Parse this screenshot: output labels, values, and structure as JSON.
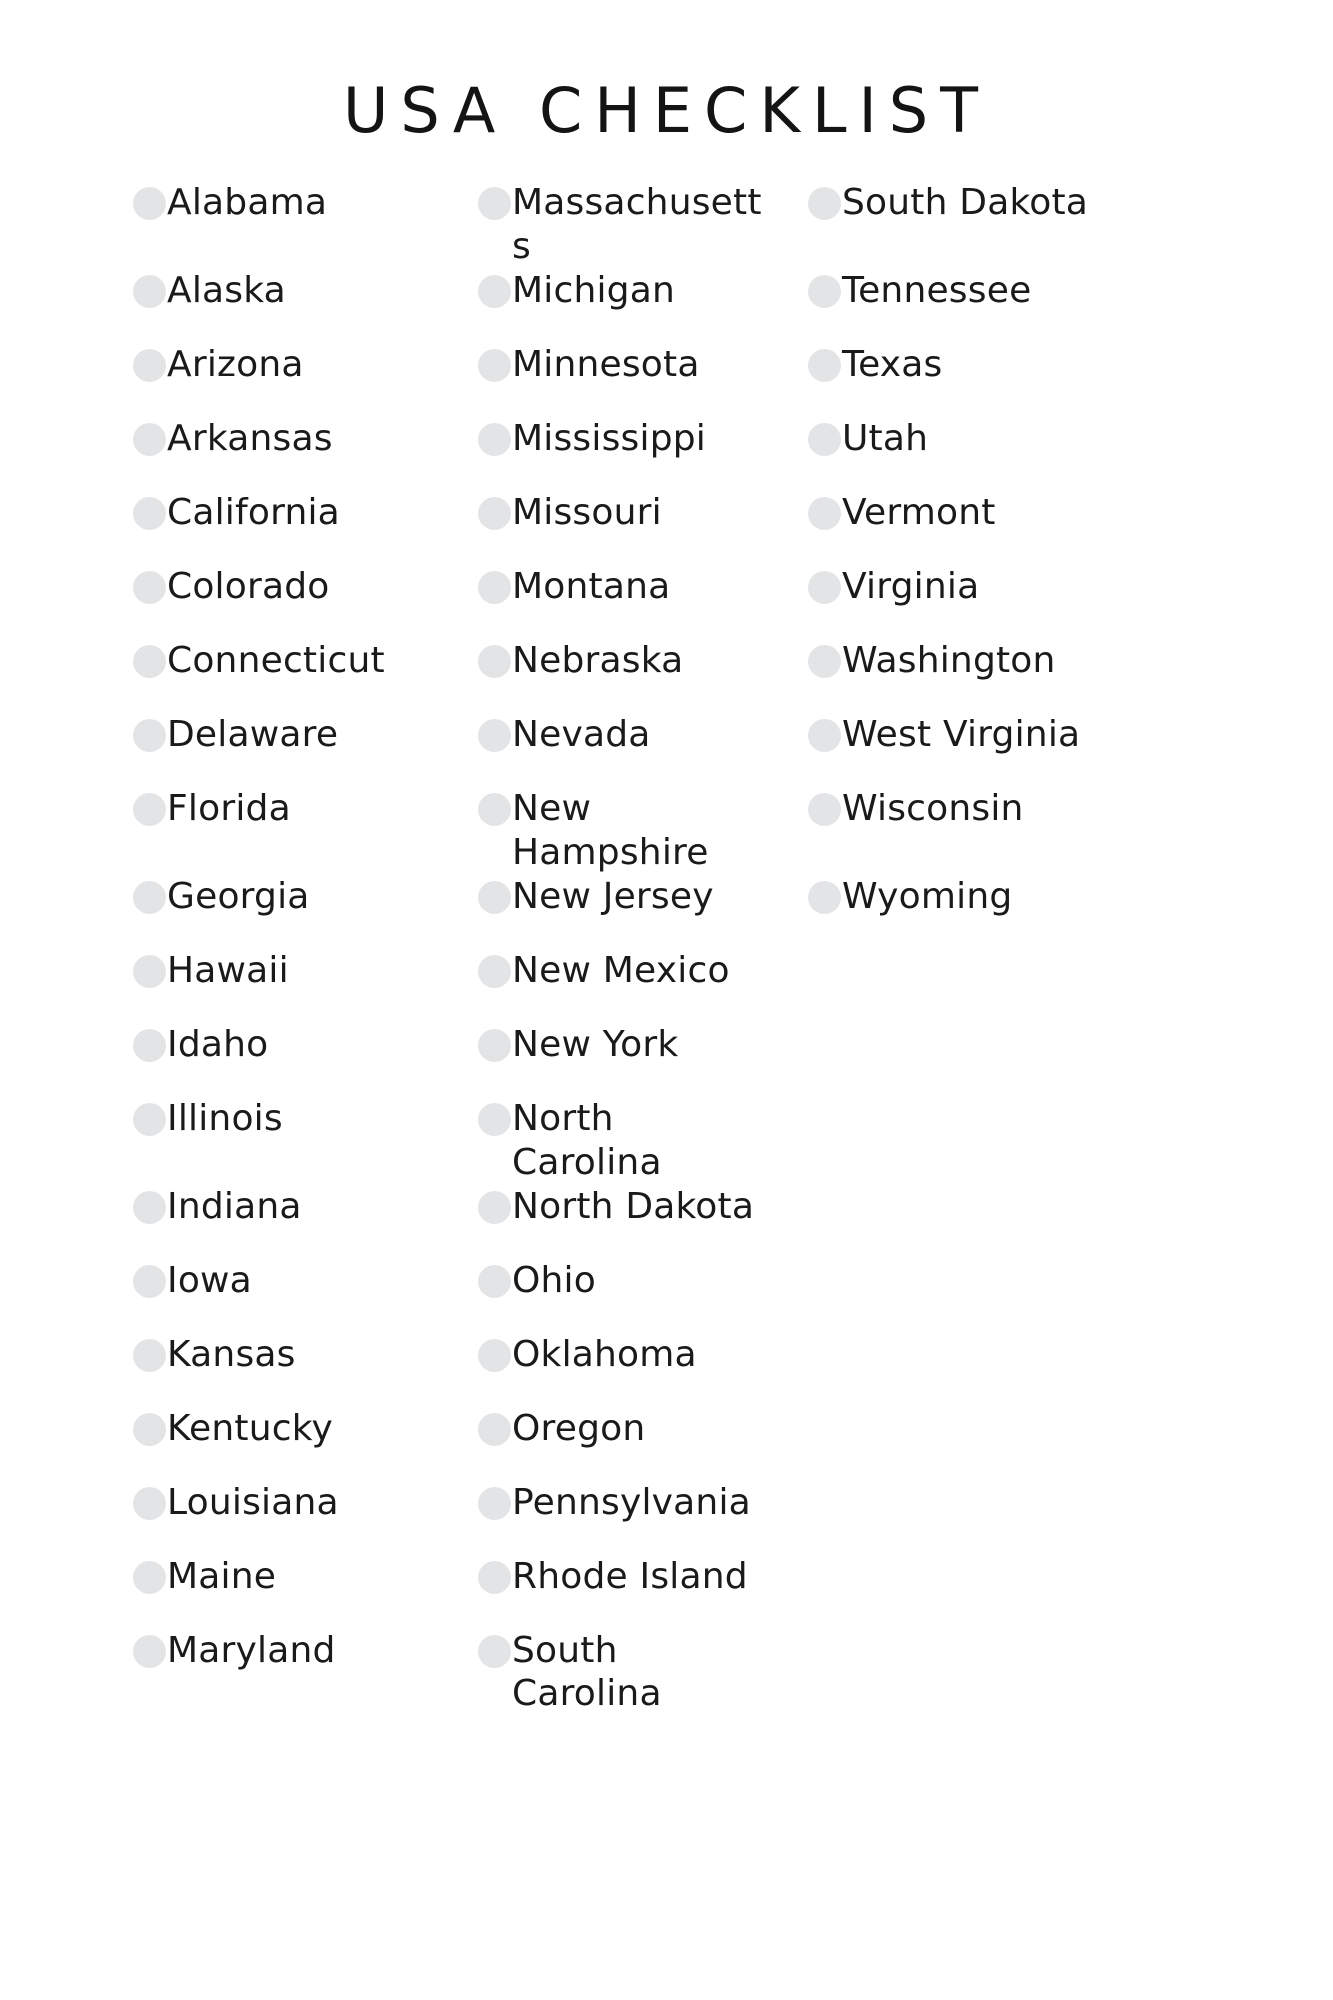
{
  "document": {
    "title": "USA CHECKLIST",
    "background_color": "#ffffff",
    "text_color": "#1a1a1a",
    "checkbox_color": "#e3e4e6",
    "checkbox_shape": "circle",
    "columns": 3,
    "total_items": 50
  },
  "checklist": {
    "columns": [
      {
        "index": 1,
        "items": [
          {
            "label": "Alabama",
            "checked": false
          },
          {
            "label": "Alaska",
            "checked": false
          },
          {
            "label": "Arizona",
            "checked": false
          },
          {
            "label": "Arkansas",
            "checked": false
          },
          {
            "label": "California",
            "checked": false
          },
          {
            "label": "Colorado",
            "checked": false
          },
          {
            "label": "Connecticut",
            "checked": false
          },
          {
            "label": "Delaware",
            "checked": false
          },
          {
            "label": "Florida",
            "checked": false
          },
          {
            "label": "Georgia",
            "checked": false
          },
          {
            "label": "Hawaii",
            "checked": false
          },
          {
            "label": "Idaho",
            "checked": false
          },
          {
            "label": "Illinois",
            "checked": false
          },
          {
            "label": "Indiana",
            "checked": false
          },
          {
            "label": "Iowa",
            "checked": false
          },
          {
            "label": "Kansas",
            "checked": false
          },
          {
            "label": "Kentucky",
            "checked": false
          },
          {
            "label": "Louisiana",
            "checked": false
          },
          {
            "label": "Maine",
            "checked": false
          },
          {
            "label": "Maryland",
            "checked": false
          }
        ]
      },
      {
        "index": 2,
        "items": [
          {
            "label": "Massachusetts",
            "checked": false
          },
          {
            "label": "Michigan",
            "checked": false
          },
          {
            "label": "Minnesota",
            "checked": false
          },
          {
            "label": "Mississippi",
            "checked": false
          },
          {
            "label": "Missouri",
            "checked": false
          },
          {
            "label": "Montana",
            "checked": false
          },
          {
            "label": "Nebraska",
            "checked": false
          },
          {
            "label": "Nevada",
            "checked": false
          },
          {
            "label": "New Hampshire",
            "checked": false
          },
          {
            "label": "New Jersey",
            "checked": false
          },
          {
            "label": "New Mexico",
            "checked": false
          },
          {
            "label": "New York",
            "checked": false
          },
          {
            "label": "North Carolina",
            "checked": false
          },
          {
            "label": "North Dakota",
            "checked": false
          },
          {
            "label": "Ohio",
            "checked": false
          },
          {
            "label": "Oklahoma",
            "checked": false
          },
          {
            "label": "Oregon",
            "checked": false
          },
          {
            "label": "Pennsylvania",
            "checked": false
          },
          {
            "label": "Rhode Island",
            "checked": false
          },
          {
            "label": "South Carolina",
            "checked": false
          }
        ]
      },
      {
        "index": 3,
        "items": [
          {
            "label": "South Dakota",
            "checked": false
          },
          {
            "label": "Tennessee",
            "checked": false
          },
          {
            "label": "Texas",
            "checked": false
          },
          {
            "label": "Utah",
            "checked": false
          },
          {
            "label": "Vermont",
            "checked": false
          },
          {
            "label": "Virginia",
            "checked": false
          },
          {
            "label": "Washington",
            "checked": false
          },
          {
            "label": "West Virginia",
            "checked": false
          },
          {
            "label": "Wisconsin",
            "checked": false
          },
          {
            "label": "Wyoming",
            "checked": false
          },
          {
            "label": "",
            "checked": false
          },
          {
            "label": "",
            "checked": false
          },
          {
            "label": "",
            "checked": false
          },
          {
            "label": "",
            "checked": false
          },
          {
            "label": "",
            "checked": false
          },
          {
            "label": "",
            "checked": false
          },
          {
            "label": "",
            "checked": false
          },
          {
            "label": "",
            "checked": false
          },
          {
            "label": "",
            "checked": false
          },
          {
            "label": "",
            "checked": false
          }
        ]
      }
    ]
  }
}
